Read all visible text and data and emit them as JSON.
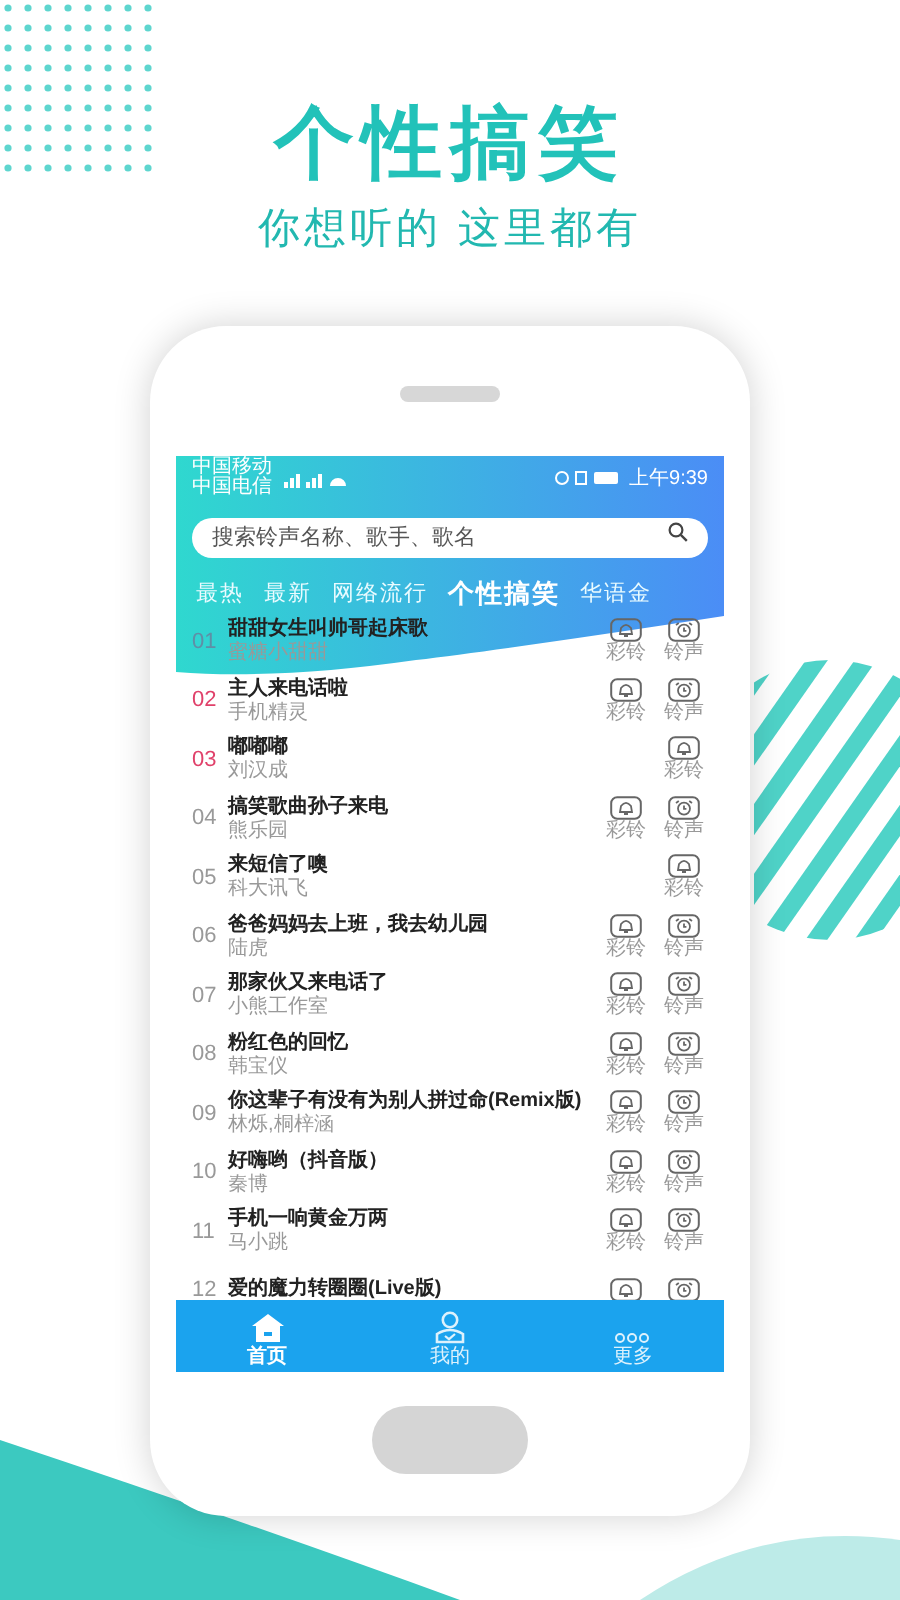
{
  "headline": "个性搞笑",
  "subtitle": "你想听的 这里都有",
  "status_bar": {
    "carriers": [
      "中国移动",
      "中国电信"
    ],
    "time": "上午9:39"
  },
  "search": {
    "placeholder": "搜索铃声名称、歌手、歌名"
  },
  "tabs": [
    {
      "label": "最热",
      "selected": false
    },
    {
      "label": "最新",
      "selected": false
    },
    {
      "label": "网络流行",
      "selected": false
    },
    {
      "label": "个性搞笑",
      "selected": true
    },
    {
      "label": "华语金",
      "selected": false
    }
  ],
  "songs": [
    {
      "rank": "01",
      "top": false,
      "title": "甜甜女生叫帅哥起床歌",
      "artist": "蜜糖小甜甜",
      "buttons": [
        {
          "kind": "bell",
          "label": "彩铃"
        },
        {
          "kind": "alarm",
          "label": "铃声"
        }
      ]
    },
    {
      "rank": "02",
      "top": true,
      "title": "主人来电话啦",
      "artist": "手机精灵",
      "buttons": [
        {
          "kind": "bell",
          "label": "彩铃"
        },
        {
          "kind": "alarm",
          "label": "铃声"
        }
      ]
    },
    {
      "rank": "03",
      "top": true,
      "title": "嘟嘟嘟",
      "artist": "刘汉成",
      "buttons": [
        {
          "kind": "bell",
          "label": "彩铃"
        }
      ]
    },
    {
      "rank": "04",
      "top": false,
      "title": "搞笑歌曲孙子来电",
      "artist": "熊乐园",
      "buttons": [
        {
          "kind": "bell",
          "label": "彩铃"
        },
        {
          "kind": "alarm",
          "label": "铃声"
        }
      ]
    },
    {
      "rank": "05",
      "top": false,
      "title": "来短信了噢",
      "artist": "科大讯飞",
      "buttons": [
        {
          "kind": "bell",
          "label": "彩铃"
        }
      ]
    },
    {
      "rank": "06",
      "top": false,
      "title": "爸爸妈妈去上班，我去幼儿园",
      "artist": "陆虎",
      "buttons": [
        {
          "kind": "bell",
          "label": "彩铃"
        },
        {
          "kind": "alarm",
          "label": "铃声"
        }
      ]
    },
    {
      "rank": "07",
      "top": false,
      "title": "那家伙又来电话了",
      "artist": "小熊工作室",
      "buttons": [
        {
          "kind": "bell",
          "label": "彩铃"
        },
        {
          "kind": "alarm",
          "label": "铃声"
        }
      ]
    },
    {
      "rank": "08",
      "top": false,
      "title": "粉红色的回忆",
      "artist": "韩宝仪",
      "buttons": [
        {
          "kind": "bell",
          "label": "彩铃"
        },
        {
          "kind": "alarm",
          "label": "铃声"
        }
      ]
    },
    {
      "rank": "09",
      "top": false,
      "title": "你这辈子有没有为别人拼过命(Remix版)",
      "artist": "林烁,桐梓涵",
      "buttons": [
        {
          "kind": "bell",
          "label": "彩铃"
        },
        {
          "kind": "alarm",
          "label": "铃声"
        }
      ]
    },
    {
      "rank": "10",
      "top": false,
      "title": "好嗨哟（抖音版）",
      "artist": "秦博",
      "buttons": [
        {
          "kind": "bell",
          "label": "彩铃"
        },
        {
          "kind": "alarm",
          "label": "铃声"
        }
      ]
    },
    {
      "rank": "11",
      "top": false,
      "title": "手机一响黄金万两",
      "artist": "马小跳",
      "buttons": [
        {
          "kind": "bell",
          "label": "彩铃"
        },
        {
          "kind": "alarm",
          "label": "铃声"
        }
      ]
    },
    {
      "rank": "12",
      "top": false,
      "title": "爱的魔力转圈圈(Live版)",
      "buttons": [
        {
          "kind": "bell"
        },
        {
          "kind": "alarm"
        }
      ]
    }
  ],
  "nav": [
    {
      "kind": "home",
      "label": "首页",
      "selected": true
    },
    {
      "kind": "person",
      "label": "我的",
      "selected": false
    },
    {
      "kind": "more",
      "label": "更多",
      "selected": false
    }
  ]
}
